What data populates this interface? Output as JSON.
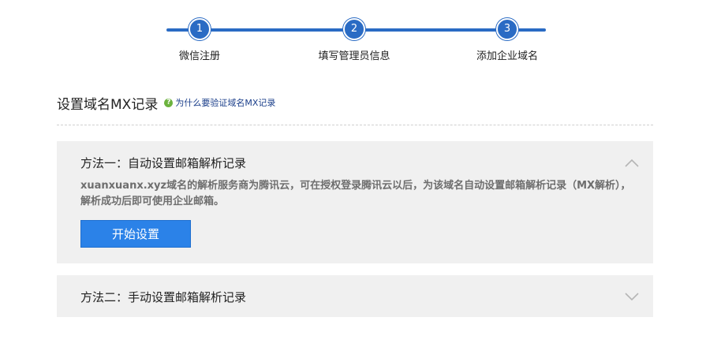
{
  "stepper": {
    "steps": [
      {
        "number": "1",
        "label": "微信注册"
      },
      {
        "number": "2",
        "label": "填写管理员信息"
      },
      {
        "number": "3",
        "label": "添加企业域名"
      }
    ]
  },
  "header": {
    "title": "设置域名MX记录",
    "help_icon": "question-icon",
    "help_link": "为什么要验证域名MX记录"
  },
  "methods": [
    {
      "title": "方法一：自动设置邮箱解析记录",
      "expanded": true,
      "description": "xuanxuanx.xyz域名的解析服务商为腾讯云，可在授权登录腾讯云以后，为该域名自动设置邮箱解析记录（MX解析），解析成功后即可使用企业邮箱。",
      "button": "开始设置",
      "chevron_icon": "chevron-up-icon"
    },
    {
      "title": "方法二：手动设置邮箱解析记录",
      "expanded": false,
      "chevron_icon": "chevron-down-icon"
    }
  ],
  "colors": {
    "accent": "#2a6bc4",
    "button": "#2b82e8",
    "panel_bg": "#f0f0f0",
    "help_icon": "#6cb33e",
    "help_link": "#1a3e8a"
  }
}
